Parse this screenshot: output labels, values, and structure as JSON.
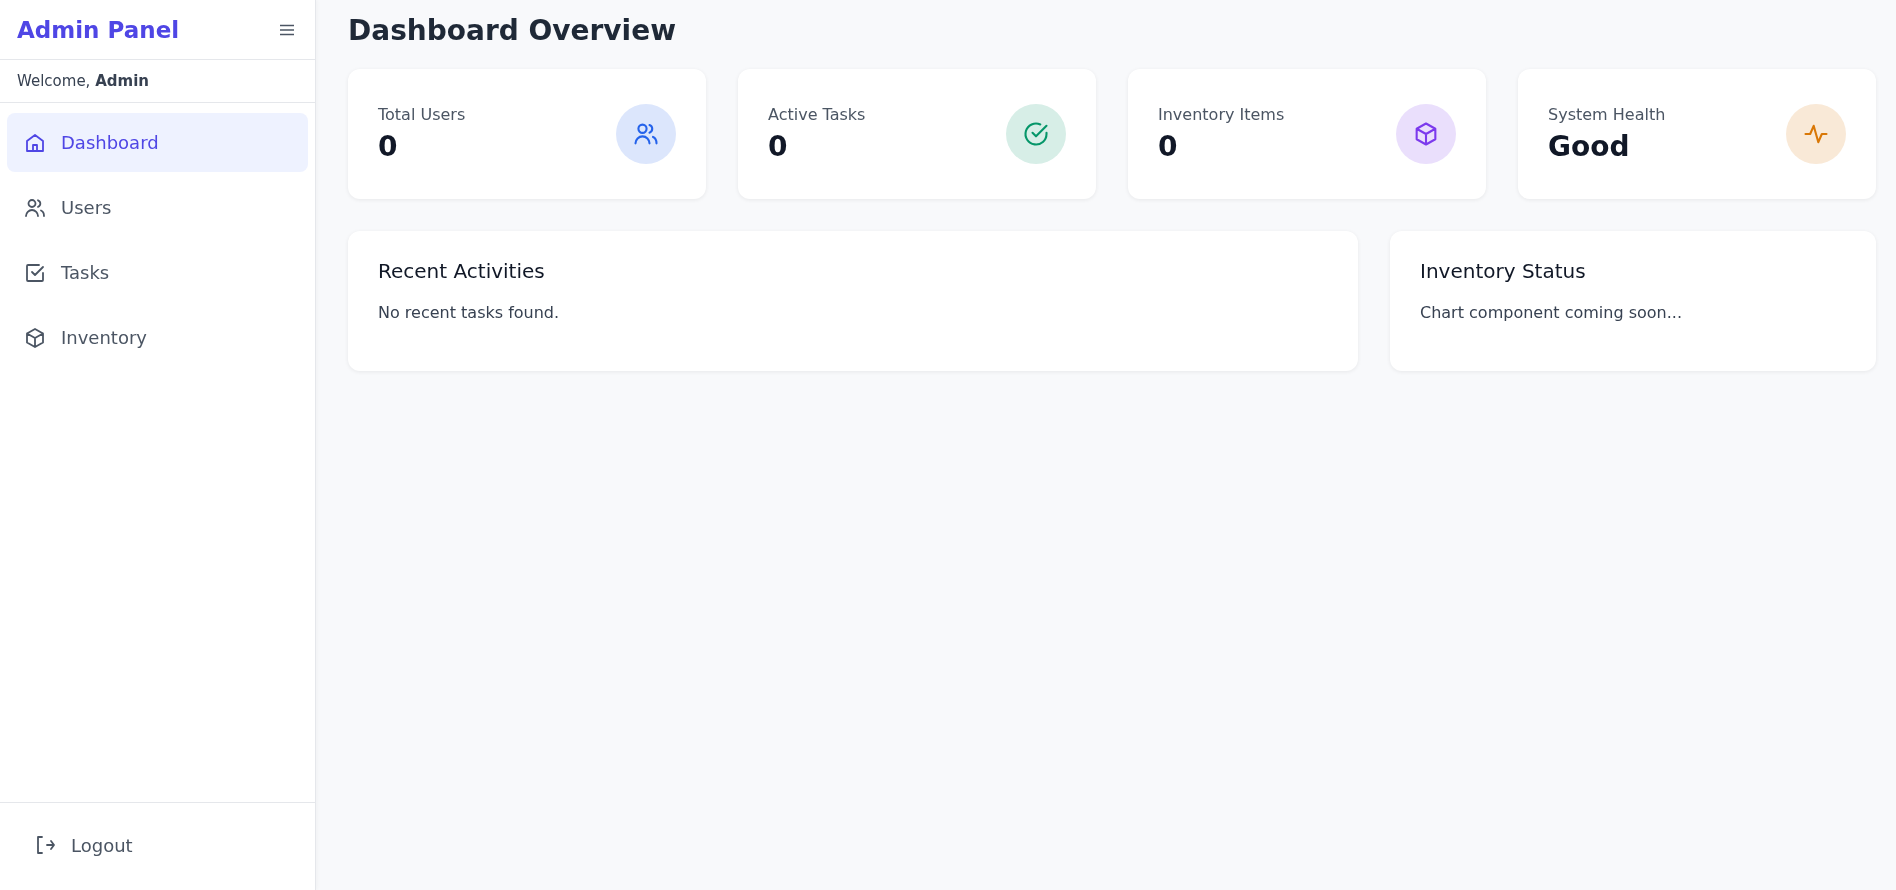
{
  "sidebar": {
    "title": "Admin Panel",
    "welcome": "Welcome, **Admin**",
    "items": [
      {
        "kind": "home",
        "label": "Dashboard",
        "selected": true
      },
      {
        "kind": "users",
        "label": "Users",
        "selected": false
      },
      {
        "kind": "tasks",
        "label": "Tasks",
        "selected": false
      },
      {
        "kind": "box",
        "label": "Inventory",
        "selected": false
      }
    ],
    "logout": "Logout"
  },
  "main": {
    "title": "Dashboard Overview",
    "stats": [
      {
        "kind": "users",
        "label": "Total Users",
        "value": "0",
        "color": "#2563eb"
      },
      {
        "kind": "check",
        "label": "Active Tasks",
        "value": "0",
        "color": "#059669"
      },
      {
        "kind": "box",
        "label": "Inventory Items",
        "value": "0",
        "color": "#7c3aed"
      },
      {
        "kind": "activity",
        "label": "System Health",
        "value": "Good",
        "color": "#d97706"
      }
    ],
    "panels": [
      {
        "title": "Recent Activities",
        "text": "No recent tasks found."
      },
      {
        "title": "Inventory Status",
        "text": "Chart component coming soon..."
      }
    ]
  }
}
